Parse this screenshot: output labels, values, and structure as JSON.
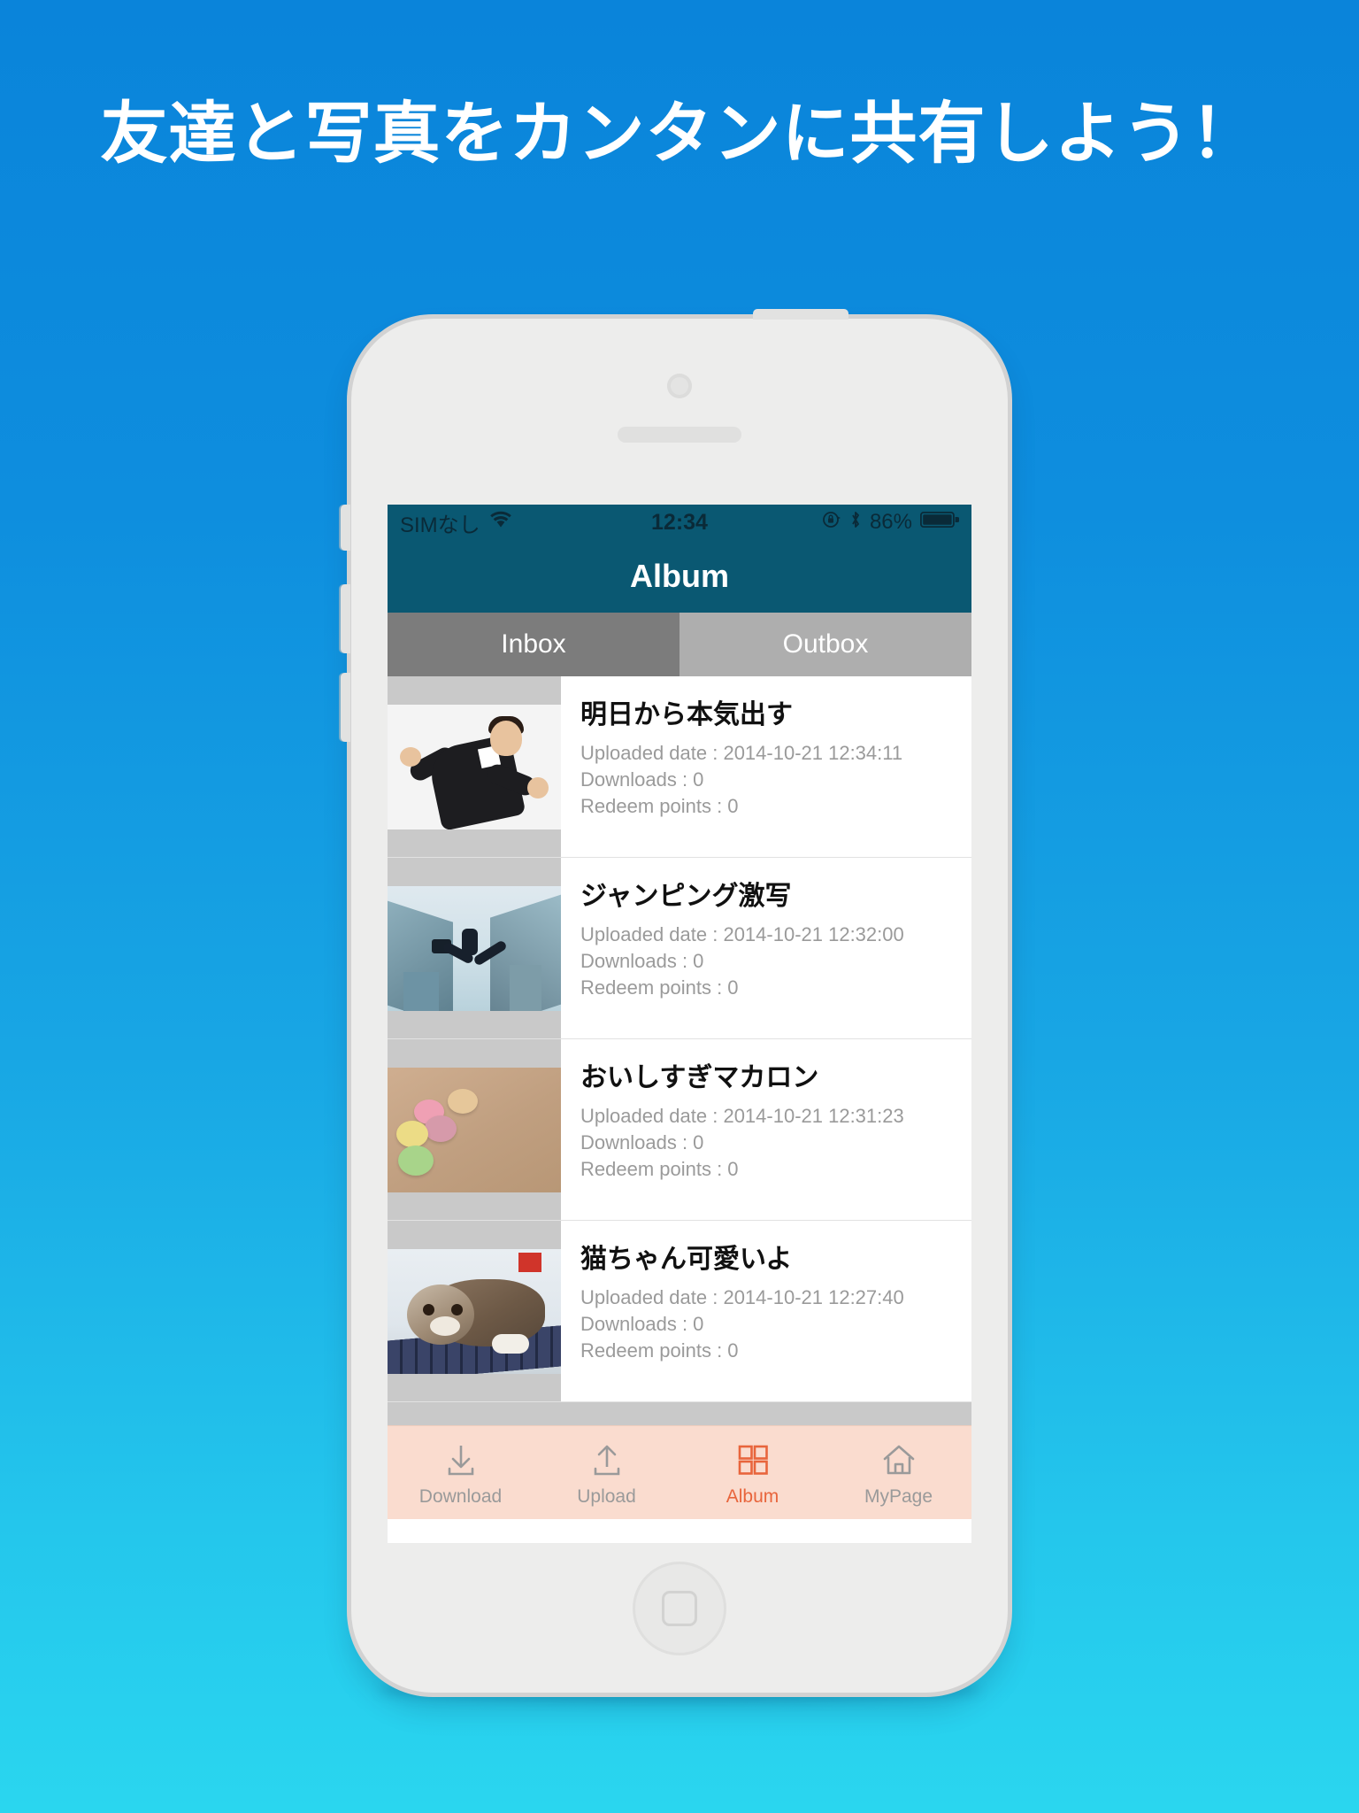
{
  "promo": {
    "headline": "友達と写真をカンタンに共有しよう！",
    "background_gradient_from": "#0a84da",
    "background_gradient_to": "#2ad6ef",
    "headline_color": "#ffffff"
  },
  "device": {
    "frame_color": "#ededec",
    "type": "smartphone"
  },
  "statusbar": {
    "carrier": "SIMなし",
    "wifi_icon": "wifi-icon",
    "time": "12:34",
    "rotation_lock_icon": "rotation-lock-icon",
    "bluetooth_icon": "bluetooth-icon",
    "battery_percent": "86%",
    "battery_icon": "battery-icon",
    "background": "#0a5872"
  },
  "navbar": {
    "title": "Album",
    "background": "#0a5872",
    "title_color": "#ffffff"
  },
  "segmented_tabs": {
    "selected_index": 0,
    "selected_color": "#7c7c7c",
    "unselected_color": "#aeaeae",
    "items": [
      {
        "label": "Inbox",
        "selected": true
      },
      {
        "label": "Outbox",
        "selected": false
      }
    ]
  },
  "list": {
    "labels": {
      "uploaded_date": "Uploaded date :",
      "downloads": "Downloads :",
      "redeem_points": "Redeem points :"
    },
    "rows": [
      {
        "title": "明日から本気出す",
        "uploaded_date_line": "Uploaded date : 2014-10-21 12:34:11",
        "downloads_line": "Downloads : 0",
        "redeem_points_line": "Redeem points : 0",
        "uploaded_date": "2014-10-21 12:34:11",
        "downloads": "0",
        "redeem_points": "0",
        "thumbnail": "man-in-suit-photo"
      },
      {
        "title": "ジャンピング激写",
        "uploaded_date_line": "Uploaded date : 2014-10-21 12:32:00",
        "downloads_line": "Downloads : 0",
        "redeem_points_line": "Redeem points : 0",
        "uploaded_date": "2014-10-21 12:32:00",
        "downloads": "0",
        "redeem_points": "0",
        "thumbnail": "businessman-jumping-between-buildings-photo"
      },
      {
        "title": "おいしすぎマカロン",
        "uploaded_date_line": "Uploaded date : 2014-10-21 12:31:23",
        "downloads_line": "Downloads : 0",
        "redeem_points_line": "Redeem points : 0",
        "uploaded_date": "2014-10-21 12:31:23",
        "downloads": "0",
        "redeem_points": "0",
        "thumbnail": "macarons-photo"
      },
      {
        "title": "猫ちゃん可愛いよ",
        "uploaded_date_line": "Uploaded date : 2014-10-21 12:27:40",
        "downloads_line": "Downloads : 0",
        "redeem_points_line": "Redeem points : 0",
        "uploaded_date": "2014-10-21 12:27:40",
        "downloads": "0",
        "redeem_points": "0",
        "thumbnail": "kitten-on-keyboard-photo"
      }
    ]
  },
  "toolbar": {
    "background": "#fadccf",
    "active_color": "#e8653c",
    "inactive_color": "#9a9a9a",
    "active_index": 2,
    "items": [
      {
        "label": "Download",
        "icon": "download-icon",
        "active": false
      },
      {
        "label": "Upload",
        "icon": "upload-icon",
        "active": false
      },
      {
        "label": "Album",
        "icon": "grid-icon",
        "active": true
      },
      {
        "label": "MyPage",
        "icon": "home-icon",
        "active": false
      }
    ]
  }
}
